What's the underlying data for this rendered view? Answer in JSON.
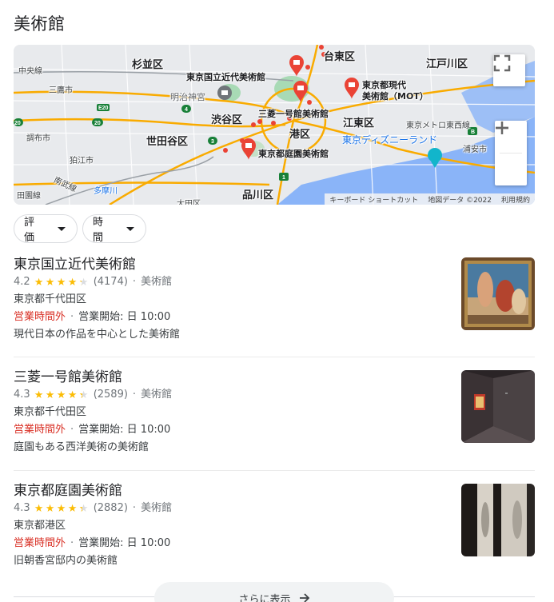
{
  "page": {
    "title": "美術館"
  },
  "map": {
    "labels": {
      "suginami": "杉並区",
      "nakano": "中央線",
      "mitaka": "三鷹市",
      "taito": "台東区",
      "edogawa": "江戸川区",
      "momat_pin": "東京国立近代美術館",
      "mot_pin": "東京都現代\n美術館（MOT）",
      "meiji": "明治神宮",
      "mitsubishi_pin": "三菱一号館美術館",
      "shibuya": "渋谷区",
      "minato": "港区",
      "koto": "江東区",
      "metro_tozai": "東京メトロ東西線",
      "chofu": "調布市",
      "setagaya": "世田谷区",
      "teien_pin": "東京都庭園美術館",
      "disney": "東京ディズニーランド",
      "urayasu": "浦安市",
      "komae": "狛江市",
      "nambu": "南武線",
      "tamagawa": "多摩川",
      "shinagawa": "品川区",
      "denentoshi": "田園線",
      "ota": "大田区"
    },
    "attribution": {
      "shortcuts": "キーボード ショートカット",
      "data": "地図データ ©2022",
      "terms": "利用規約"
    }
  },
  "filters": {
    "rating": "評価",
    "hours": "時間"
  },
  "results": [
    {
      "name": "東京国立近代美術館",
      "rating": "4.2",
      "stars_value": 4.2,
      "reviews": "(4174)",
      "category": "美術館",
      "address": "東京都千代田区",
      "status": "営業時間外",
      "opens": "営業開始: 日 10:00",
      "description": "現代日本の作品を中心とした美術館"
    },
    {
      "name": "三菱一号館美術館",
      "rating": "4.3",
      "stars_value": 4.3,
      "reviews": "(2589)",
      "category": "美術館",
      "address": "東京都千代田区",
      "status": "営業時間外",
      "opens": "営業開始: 日 10:00",
      "description": "庭園もある西洋美術の美術館"
    },
    {
      "name": "東京都庭園美術館",
      "rating": "4.3",
      "stars_value": 4.3,
      "reviews": "(2882)",
      "category": "美術館",
      "address": "東京都港区",
      "status": "営業時間外",
      "opens": "営業開始: 日 10:00",
      "description": "旧朝香宮邸内の美術館"
    }
  ],
  "more": {
    "label": "さらに表示"
  },
  "colors": {
    "closed": "#d93025",
    "star": "#fbbc04",
    "pin": "#ea4335"
  }
}
